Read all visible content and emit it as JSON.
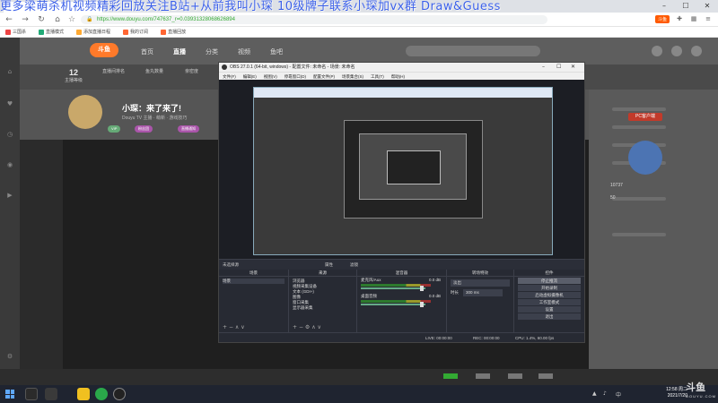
{
  "overlay": {
    "marquee": "更多梁萌杀机视频精彩回放关注B站+从前我叫小琛    10级牌子联系小琛加vx群   Draw&Guess"
  },
  "browser": {
    "url": "https://www.douyu.com/747637_r=0.03931328068626894",
    "url_scheme": "https://",
    "brand_ext": "斗鱼",
    "bookmarks": [
      "三国杀",
      "直播模式",
      "添加直播日程",
      "我的订阅",
      "直播回放"
    ]
  },
  "site": {
    "logo": "斗鱼",
    "nav": [
      "首页",
      "直播",
      "分类",
      "视频",
      "鱼吧"
    ],
    "active_nav": 1,
    "stats": [
      {
        "value": "12",
        "label": "主播等级"
      },
      {
        "value": "",
        "label": "直播间排名"
      },
      {
        "value": "",
        "label": "鱼丸数量"
      },
      {
        "value": "",
        "label": "亲密度"
      }
    ],
    "streamer_title": "小琛：来了来了!",
    "streamer_sub": "Douyu TV 主播 · 萌新 · 游戏技巧",
    "pills": [
      "VIP",
      "粉丝团",
      "直播通知"
    ],
    "right_button": "PC客户端",
    "right_numbers": [
      "10737",
      "50"
    ]
  },
  "obs": {
    "title": "OBS 27.0.1 (64-bit, windows) - 配置文件: 未命名 - 场景: 未命名",
    "menu": [
      "文件(F)",
      "编辑(E)",
      "视图(V)",
      "停靠窗口(D)",
      "配置文件(P)",
      "场景集合(S)",
      "工具(T)",
      "帮助(H)"
    ],
    "source_bar": "未选择源",
    "source_bar_ctrls": [
      "属性",
      "滤镜"
    ],
    "docks": {
      "scenes": {
        "title": "场景",
        "items": [
          "场景"
        ]
      },
      "sources": {
        "title": "来源",
        "items": [
          "浏览器",
          "视频采集设备",
          "文本 (GDI+)",
          "图像",
          "窗口采集",
          "显示器采集"
        ]
      },
      "mixer": {
        "title": "混音器",
        "channels": [
          {
            "name": "麦克风/Aux",
            "db": "0.0 dB"
          },
          {
            "name": "桌面音频",
            "db": "0.0 dB"
          }
        ]
      },
      "transitions": {
        "title": "转场特效",
        "type": "淡出",
        "duration_label": "时长",
        "duration_value": "300 ms"
      },
      "controls": {
        "title": "控件",
        "buttons": [
          "停止推流",
          "开始录制",
          "启动虚拟摄像机",
          "工作室模式",
          "设置",
          "退出"
        ]
      }
    },
    "status": {
      "live": "LIVE: 00:00:00",
      "rec": "REC: 00:00:00",
      "cpu": "CPU: 1.4%, 60.00 fps"
    }
  },
  "taskbar": {
    "time": "12:58 周二",
    "date": "2021/7/20"
  },
  "watermark": {
    "main": "斗鱼",
    "sub": "DOUYU.COM"
  },
  "colors": {
    "marquee": "#3a5fe8",
    "accent": "#ff7a2a",
    "obs_bg": "#2b2e38"
  }
}
